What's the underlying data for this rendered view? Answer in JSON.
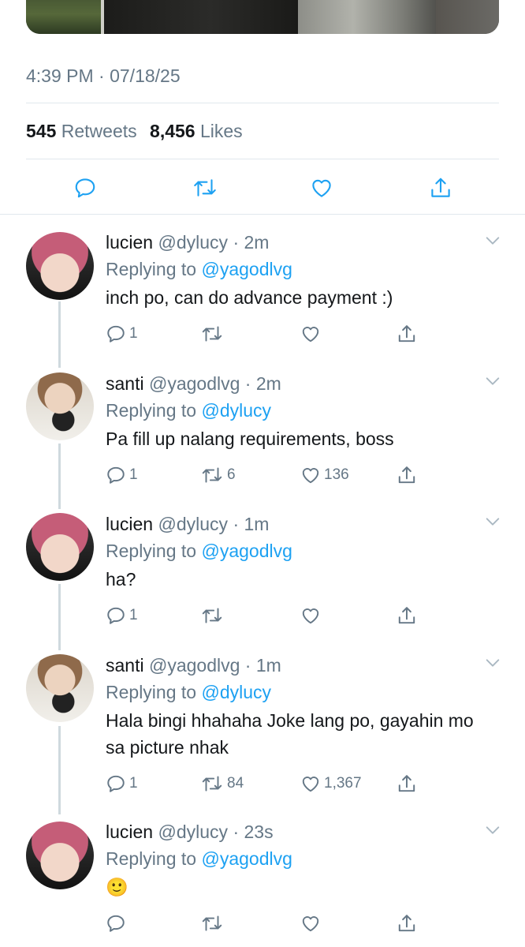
{
  "tweet": {
    "timestamp": "4:39 PM · 07/18/25",
    "retweets_count": "545",
    "retweets_label": "Retweets",
    "likes_count": "8,456",
    "likes_label": "Likes"
  },
  "icons": {
    "reply": "reply-icon",
    "retweet": "retweet-icon",
    "like": "heart-icon",
    "share": "share-icon",
    "more": "chevron-down-icon"
  },
  "colors": {
    "text": "#14171a",
    "secondary": "#657786",
    "link": "#1da1f2",
    "divider": "#e1e8ed"
  },
  "replies": [
    {
      "name": "lucien",
      "handle": "@dylucy",
      "time": "· 2m",
      "replying_prefix": "Replying to",
      "replying_to": "@yagodlvg",
      "text": "inch po, can do advance payment :)",
      "reply_count": "1",
      "retweet_count": "",
      "like_count": ""
    },
    {
      "name": "santi",
      "handle": "@yagodlvg",
      "time": "· 2m",
      "replying_prefix": "Replying to",
      "replying_to": "@dylucy",
      "text": "Pa fill up nalang requirements, boss",
      "reply_count": "1",
      "retweet_count": "6",
      "like_count": "136"
    },
    {
      "name": "lucien",
      "handle": "@dylucy",
      "time": "· 1m",
      "replying_prefix": "Replying to",
      "replying_to": "@yagodlvg",
      "text": "ha?",
      "reply_count": "1",
      "retweet_count": "",
      "like_count": ""
    },
    {
      "name": "santi",
      "handle": "@yagodlvg",
      "time": "· 1m",
      "replying_prefix": "Replying to",
      "replying_to": "@dylucy",
      "text": "Hala bingi hhahaha Joke lang po, gayahin mo sa picture nhak",
      "reply_count": "1",
      "retweet_count": "84",
      "like_count": "1,367"
    },
    {
      "name": "lucien",
      "handle": "@dylucy",
      "time": "· 23s",
      "replying_prefix": "Replying to",
      "replying_to": "@yagodlvg",
      "text": "🙂",
      "reply_count": "",
      "retweet_count": "",
      "like_count": ""
    }
  ]
}
